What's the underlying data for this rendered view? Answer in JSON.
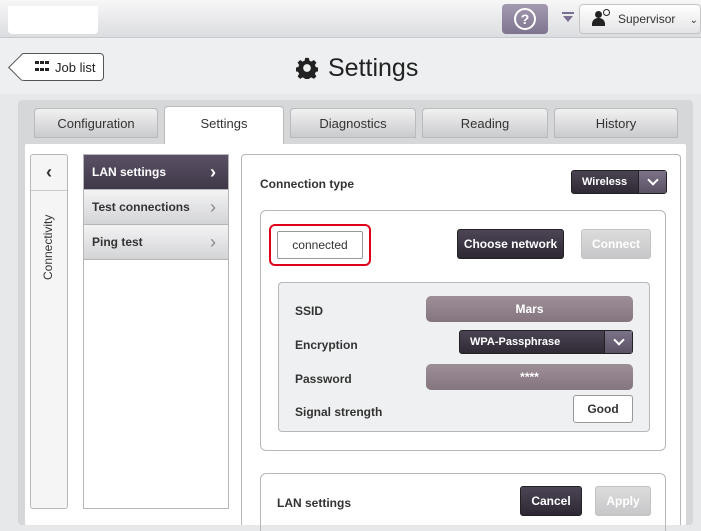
{
  "topbar": {
    "help_icon": "question-icon",
    "user_label": "Supervisor"
  },
  "header": {
    "job_list_label": "Job list",
    "title": "Settings"
  },
  "tabs": [
    {
      "label": "Configuration"
    },
    {
      "label": "Settings",
      "active": true
    },
    {
      "label": "Diagnostics"
    },
    {
      "label": "Reading"
    },
    {
      "label": "History"
    }
  ],
  "sidebar": {
    "section_label": "Connectivity",
    "items": [
      {
        "label": "LAN settings",
        "active": true
      },
      {
        "label": "Test connections"
      },
      {
        "label": "Ping test"
      }
    ]
  },
  "connection": {
    "type_label": "Connection type",
    "type_value": "Wireless",
    "status": "connected",
    "choose_network_label": "Choose network",
    "connect_label": "Connect"
  },
  "network": {
    "ssid_label": "SSID",
    "ssid_value": "Mars",
    "encryption_label": "Encryption",
    "encryption_value": "WPA-Passphrase",
    "password_label": "Password",
    "password_value": "****",
    "signal_label": "Signal strength",
    "signal_value": "Good"
  },
  "lan": {
    "label": "LAN settings",
    "cancel_label": "Cancel",
    "apply_label": "Apply"
  },
  "colors": {
    "accent_dark": "#3f3848",
    "mauve": "#8f8189",
    "highlight_red": "#e1001a"
  }
}
